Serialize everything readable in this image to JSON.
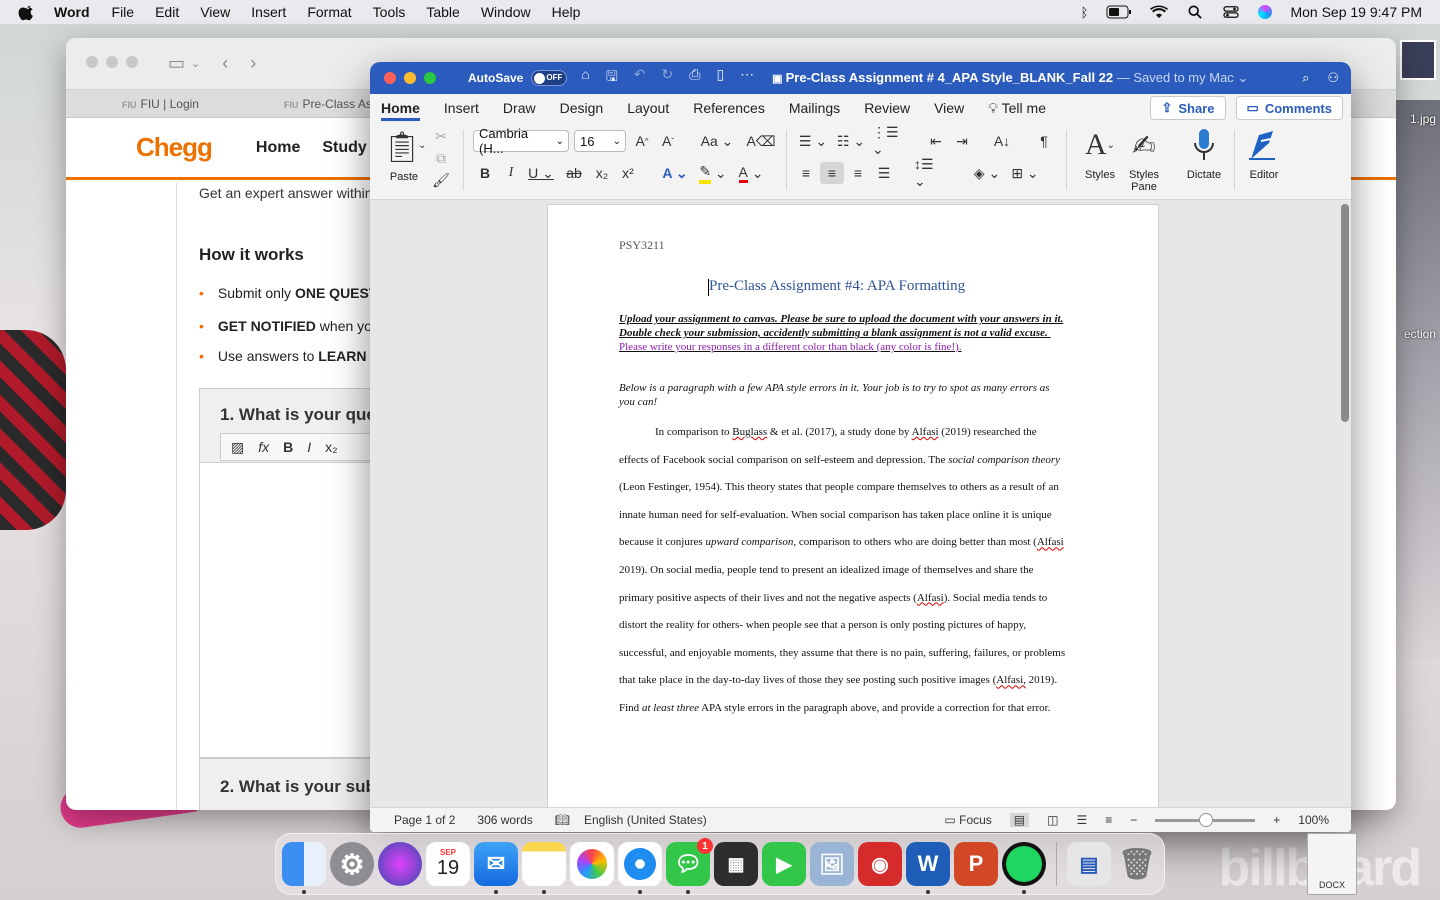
{
  "menubar": {
    "app_name": "Word",
    "items": [
      "File",
      "Edit",
      "View",
      "Insert",
      "Format",
      "Tools",
      "Table",
      "Window",
      "Help"
    ],
    "datetime": "Mon Sep 19  9:47 PM"
  },
  "safari": {
    "tabs": [
      "FIU | Login",
      "Pre-Class As"
    ],
    "tab_prefix": "FIU",
    "chegg": {
      "logo": "Chegg",
      "nav": [
        "Home",
        "Study to"
      ],
      "intro": "Get an expert answer within",
      "how_it_works": "How it works",
      "bullets": [
        {
          "pre": "Submit only ",
          "bold": "ONE QUEST",
          "post": ""
        },
        {
          "pre": "",
          "bold": "GET NOTIFIED",
          "post": " when yo"
        },
        {
          "pre": "Use answers to ",
          "bold": "LEARN",
          "post": " a"
        }
      ],
      "q1": "1. What is your que",
      "q2": "2. What is your sub"
    }
  },
  "desktop": {
    "label_jpg": "1.jpg",
    "label_ection": "ection",
    "file_label": "DOCX",
    "watermark": "billboard"
  },
  "word": {
    "autosave_label": "AutoSave",
    "autosave_state": "OFF",
    "doc_title": "Pre-Class Assignment # 4_APA Style_BLANK_Fall 22",
    "saved_status": "— Saved to my Mac",
    "tabs": [
      "Home",
      "Insert",
      "Draw",
      "Design",
      "Layout",
      "References",
      "Mailings",
      "Review",
      "View"
    ],
    "tell_me": "Tell me",
    "share": "Share",
    "comments": "Comments",
    "ribbon": {
      "paste": "Paste",
      "font_name": "Cambria (H...",
      "font_size": "16",
      "styles": "Styles",
      "styles_pane_1": "Styles",
      "styles_pane_2": "Pane",
      "dictate": "Dictate",
      "editor": "Editor"
    },
    "document": {
      "course": "PSY3211",
      "title": "Pre-Class Assignment #4: APA Formatting",
      "instructions": "Upload your assignment to canvas. Please be sure to upload the document with your answers in it. Double check your submission, accidently submitting a blank assignment is not a valid excuse.",
      "instructions_color": "Please write your responses in a different color than black (any color is fine!).",
      "below": "Below is a paragraph with a few APA style errors in it. Your job is to try to spot as many errors as you can!",
      "para_parts": {
        "p1": "In comparison to ",
        "w1": "Buglass",
        "p2": " & et al. (2017), a study done by ",
        "w2": "Alfasi",
        "p3": " (2019) researched the effects of Facebook social comparison on self-esteem and depression. The ",
        "i1": "social comparison theory",
        "p4": " (Leon Festinger, 1954). This theory states that people compare themselves to others as a result of an innate human need for self-evaluation. When social comparison has taken place online it is unique because it conjures ",
        "i2": "upward comparison,",
        "p5": " comparison to others who are doing better than most (",
        "w3": "Alfasi",
        "p6": " 2019). On social media, people tend to present an idealized image of themselves and share the primary positive aspects of their lives and not the negative aspects (",
        "w4": "Alfasi",
        "p7": "). Social media tends to distort the reality for others- when people see that a person is only posting pictures of happy, successful, and enjoyable moments, they assume that there is no pain, suffering, failures, or problems that take place in the day-to-day lives of those they see posting such positive images (",
        "w5": "Alfasi,",
        "p8": " 2019). Find ",
        "i3": "at least three",
        "p9": " APA style errors in the paragraph above, and provide a correction for that error."
      }
    },
    "status": {
      "page": "Page 1 of 2",
      "words": "306 words",
      "language": "English (United States)",
      "focus": "Focus",
      "zoom": "100%"
    }
  },
  "dock": {
    "calendar_month": "SEP",
    "calendar_day": "19",
    "messages_badge": "1"
  }
}
